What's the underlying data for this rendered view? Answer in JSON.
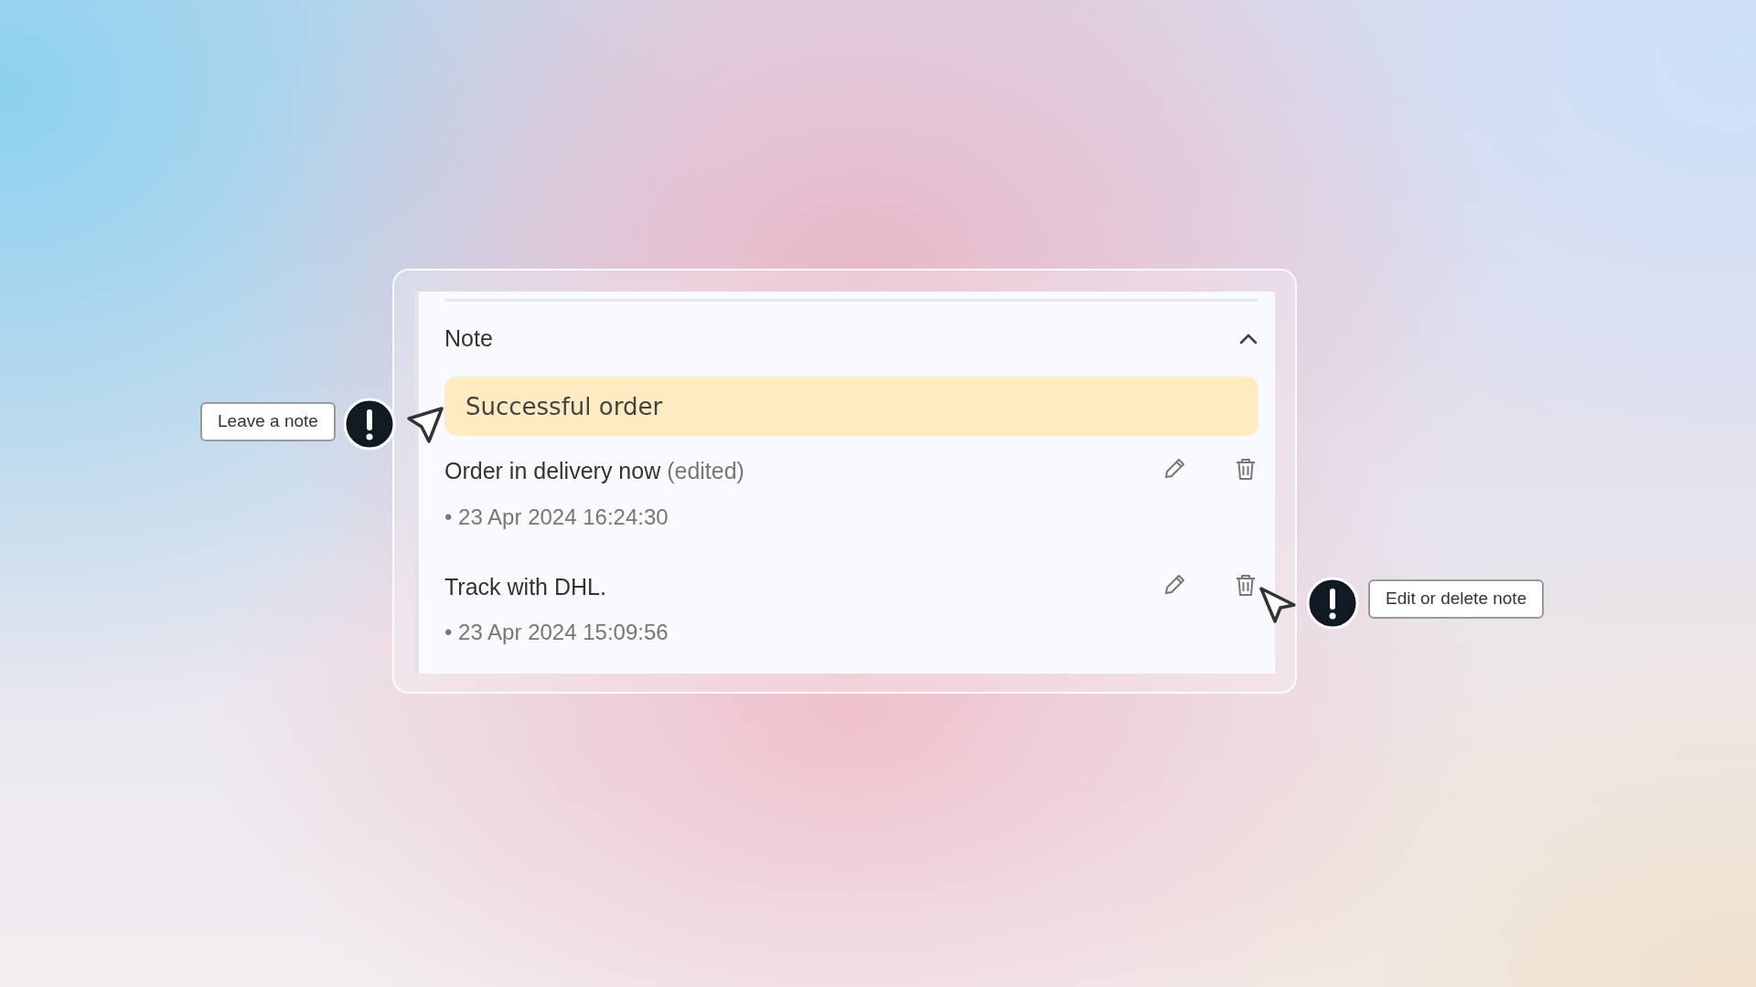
{
  "panel": {
    "title": "Note",
    "expanded": true,
    "input": {
      "value": "Successful order"
    },
    "notes": [
      {
        "text": "Order in delivery now",
        "edited": "(edited)",
        "date": "• 23 Apr 2024 16:24:30"
      },
      {
        "text": "Track with DHL.",
        "date": "• 23 Apr 2024 15:09:56"
      }
    ]
  },
  "callouts": [
    {
      "text": "Leave a note",
      "kind": "left"
    },
    {
      "text": "Edit or delete note",
      "kind": "right"
    }
  ]
}
